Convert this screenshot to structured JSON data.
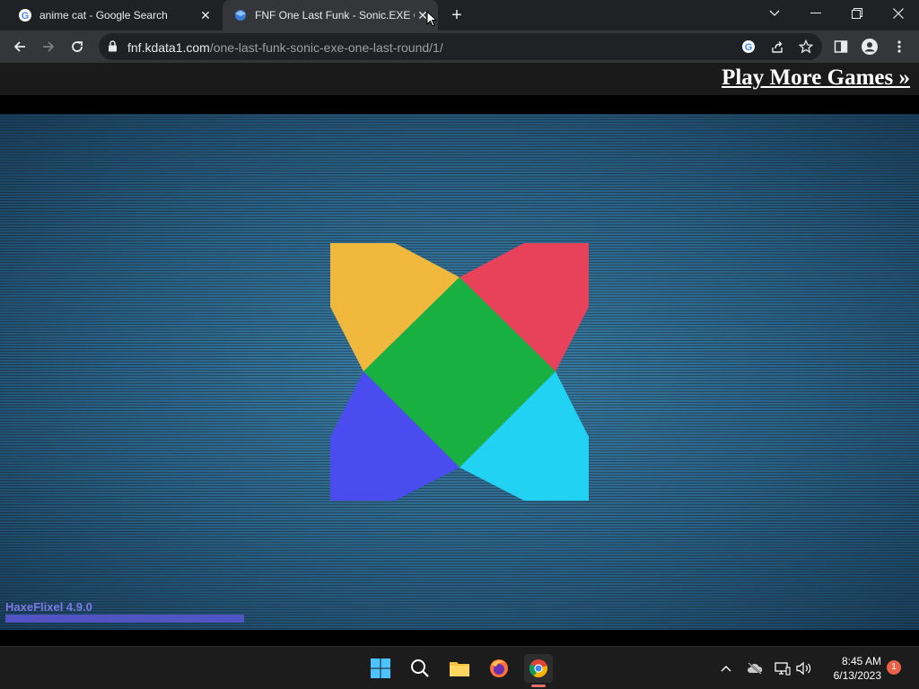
{
  "browser": {
    "tabs": [
      {
        "title": "anime cat - Google Search"
      },
      {
        "title": "FNF One Last Funk - Sonic.EXE One Last Round"
      }
    ],
    "address": {
      "domain": "fnf.kdata1.com",
      "path": "/one-last-funk-sonic-exe-one-last-round/1/"
    }
  },
  "page": {
    "play_more_label": "Play More Games »",
    "engine_label": "HaxeFlixel 4.9.0",
    "loading_progress": 0.26
  },
  "taskbar": {
    "time": "8:45 AM",
    "date": "6/13/2023",
    "notification_count": "1"
  },
  "colors": {
    "logo_yellow": "#f0b83c",
    "logo_red": "#e8425a",
    "logo_green": "#18b040",
    "logo_blue": "#4a4cf0",
    "logo_cyan": "#22d2f2"
  }
}
